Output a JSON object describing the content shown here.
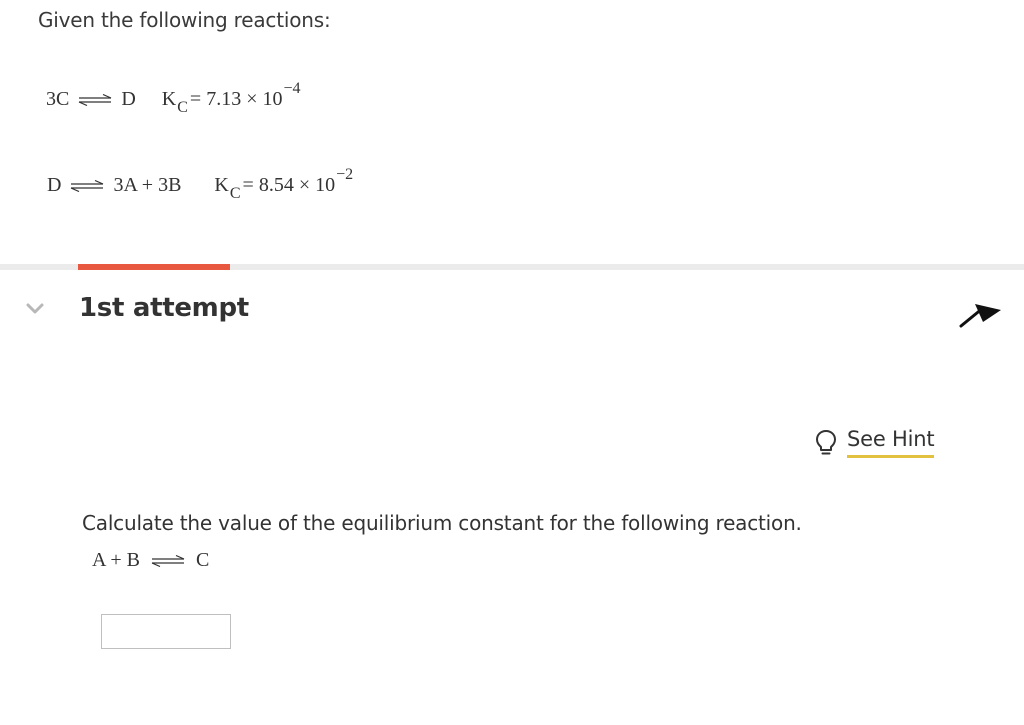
{
  "intro": "Given the following reactions:",
  "reactions": [
    {
      "reactants": "3C",
      "products": "D",
      "k_label": "K",
      "k_sub": "C",
      "k_value": "= 7.13 × 10",
      "k_exp": "−4"
    },
    {
      "reactants": "D",
      "products": "3A + 3B",
      "k_label": "K",
      "k_sub": "C",
      "k_value": "= 8.54 × 10",
      "k_exp": "−2"
    }
  ],
  "attempt": {
    "title": "1st attempt"
  },
  "hint": {
    "label": "See Hint"
  },
  "question": {
    "prompt": "Calculate the value of the equilibrium constant for the following reaction.",
    "reactants": "A + B",
    "products": "C"
  },
  "answer": {
    "value": ""
  },
  "colors": {
    "accent": "#e8573f",
    "hint_underline": "#e1c13f",
    "divider": "#ebebeb",
    "chevron": "#b8b8b8"
  },
  "icons": {
    "chevron": "chevron-down-icon",
    "pin": "pin-icon",
    "hint": "lightbulb-icon"
  }
}
